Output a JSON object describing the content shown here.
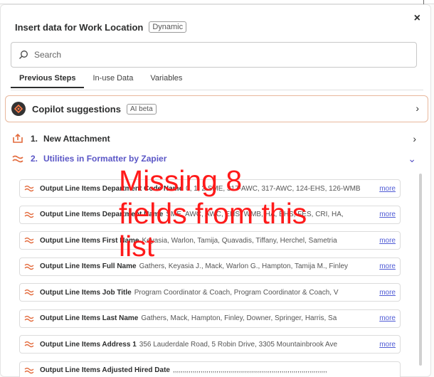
{
  "dialog": {
    "title": "Insert data for Work Location",
    "badge": "Dynamic",
    "close": "×"
  },
  "search": {
    "placeholder": "Search",
    "value": ""
  },
  "tabs": [
    {
      "label": "Previous Steps",
      "active": true
    },
    {
      "label": "In-use Data",
      "active": false
    },
    {
      "label": "Variables",
      "active": false
    }
  ],
  "copilot": {
    "label": "Copilot suggestions",
    "badge": "AI beta"
  },
  "steps": [
    {
      "number": "1.",
      "label": "New Attachment",
      "icon": "upload-icon",
      "expanded": false
    },
    {
      "number": "2.",
      "label": "Utilities in Formatter by Zapier",
      "icon": "formatter-icon",
      "expanded": true
    }
  ],
  "fields": [
    {
      "label": "Output Line Items Department Code Name",
      "value": "0, 1, 2 SME, 317-AWC, 317-AWC, 124-EHS, 126-WMB",
      "more": "more"
    },
    {
      "label": "Output Line Items Department Name",
      "value": "SME, AWC, AWC, EHS, WMB, HA, EHS, FES, CRI, HA,",
      "more": "more"
    },
    {
      "label": "Output Line Items First Name",
      "value": "Keyasia, Warlon, Tamija, Quavadis, Tiffany, Herchel, Sametria",
      "more": "more"
    },
    {
      "label": "Output Line Items Full Name",
      "value": "Gathers, Keyasia J., Mack, Warlon G., Hampton, Tamija M., Finley",
      "more": "more"
    },
    {
      "label": "Output Line Items Job Title",
      "value": "Program Coordinator & Coach, Program Coordinator & Coach, V",
      "more": "more"
    },
    {
      "label": "Output Line Items Last Name",
      "value": "Gathers, Mack, Hampton, Finley, Downer, Springer, Harris, Sa",
      "more": "more"
    },
    {
      "label": "Output Line Items Address 1",
      "value": "356 Lauderdale Road, 5 Robin Drive, 3305 Mountainbrook Ave",
      "more": "more"
    },
    {
      "label": "Output Line Items Adjusted Hired Date",
      "value": ",,,,,,,,,,,,,,,,,,,,,,,,,,,,,,,,,,,,,,,,,,,,,,,,,,,,,,,,,,,,,,,,,,,,,,,,,,,,,,",
      "more": ""
    }
  ],
  "annotation": "Missing 8 fields from this list",
  "colors": {
    "accent": "#5a56c6",
    "annotation": "#ff1a1a",
    "copilot_border": "#e8b79c",
    "link": "#4f5bd5"
  }
}
